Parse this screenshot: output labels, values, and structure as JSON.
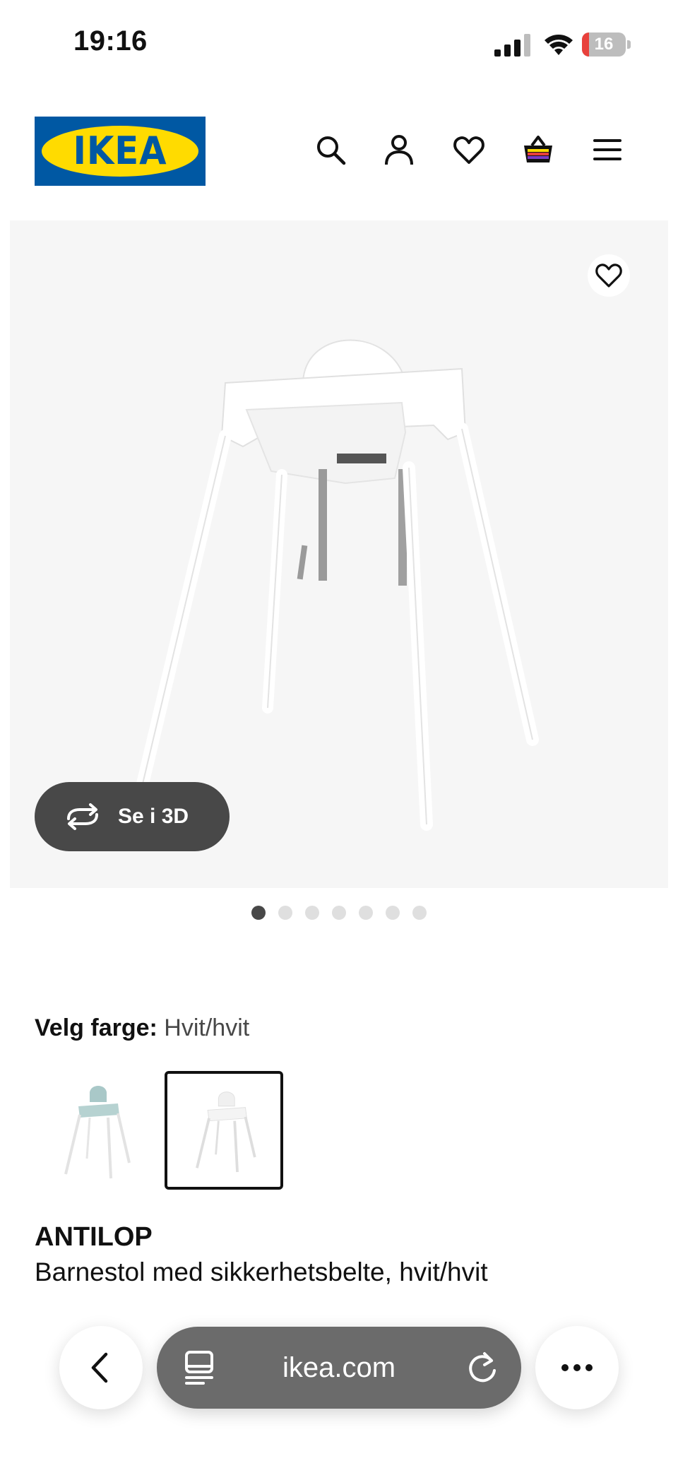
{
  "status_bar": {
    "time": "19:16",
    "battery_level": "16",
    "battery_percent": 16
  },
  "header": {
    "logo_text": "IKEA",
    "icons": [
      "search-icon",
      "account-icon",
      "heart-icon",
      "basket-icon",
      "menu-icon"
    ]
  },
  "gallery": {
    "view_3d_label": "Se i 3D",
    "image_count": 7,
    "active_image": 1
  },
  "color": {
    "label": "Velg farge:",
    "value": "Hvit/hvit",
    "options": [
      "turquoise-chair-swatch",
      "white-chair-swatch"
    ],
    "selected_index": 1
  },
  "product": {
    "name": "ANTILOP",
    "description": "Barnestol med sikkerhetsbelte, hvit/hvit"
  },
  "browser": {
    "url": "ikea.com",
    "icons": [
      "back-icon",
      "tabs-icon",
      "reload-icon",
      "more-icon"
    ]
  },
  "colors": {
    "ikea_blue": "#0058a3",
    "ikea_yellow": "#ffdb00",
    "dark_button": "#484848",
    "battery_red": "#e8413c"
  }
}
